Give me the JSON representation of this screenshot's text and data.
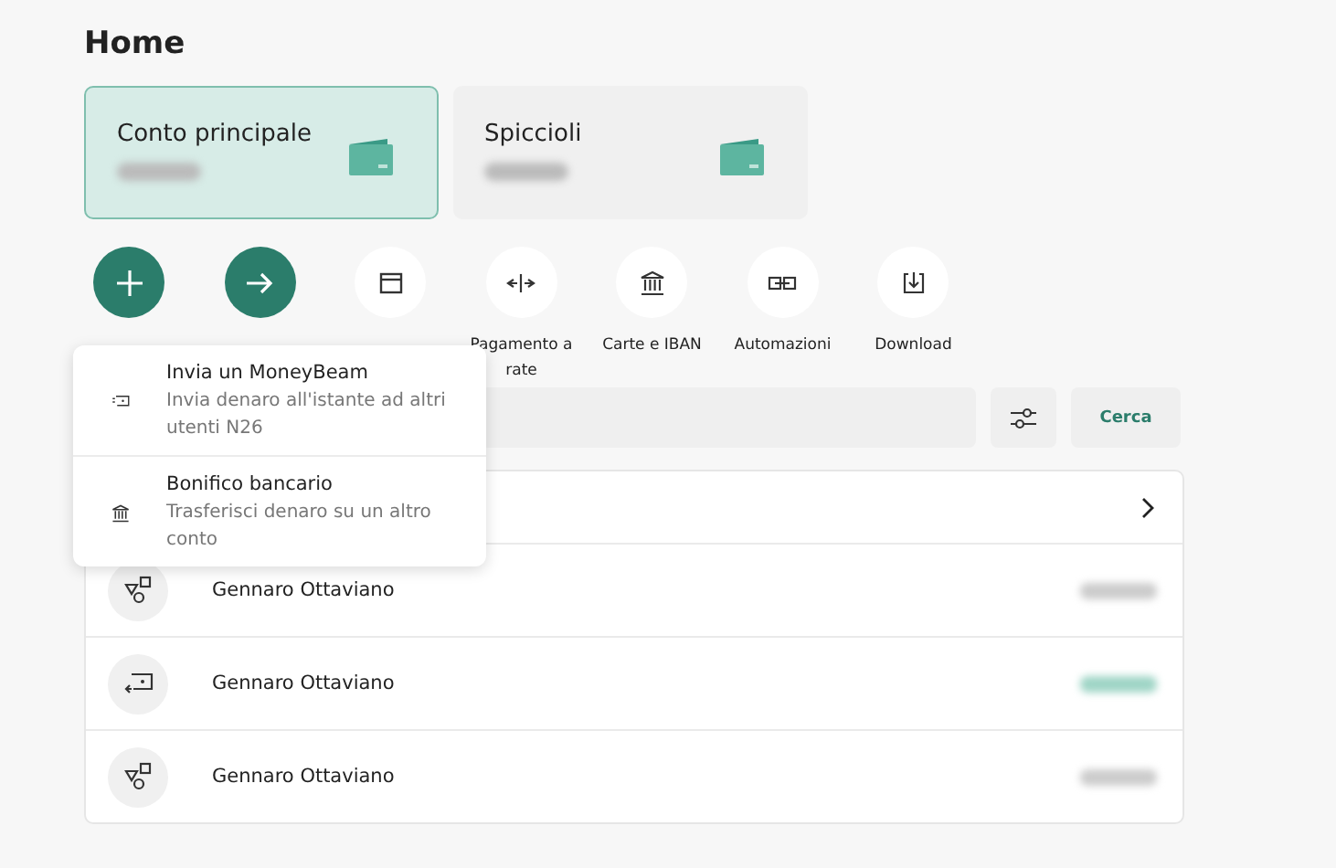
{
  "title": "Home",
  "accounts": [
    {
      "name": "Conto principale",
      "selected": true
    },
    {
      "name": "Spiccioli",
      "selected": false
    }
  ],
  "actions": [
    {
      "kind": "plus",
      "primary": true
    },
    {
      "kind": "arrow",
      "primary": true
    },
    {
      "kind": "calendar",
      "primary": false
    },
    {
      "kind": "split",
      "primary": false,
      "label": "Pagamento a rate"
    },
    {
      "kind": "bank",
      "primary": false,
      "label": "Carte e IBAN"
    },
    {
      "kind": "link",
      "primary": false,
      "label": "Automazioni"
    },
    {
      "kind": "download",
      "primary": false,
      "label": "Download"
    }
  ],
  "search": {
    "button": "Cerca"
  },
  "transactions": [
    {
      "name": "Gennaro Ottaviano",
      "kind": "shapes",
      "incoming": false
    },
    {
      "name": "Gennaro Ottaviano",
      "kind": "beam",
      "incoming": true
    },
    {
      "name": "Gennaro Ottaviano",
      "kind": "shapes",
      "incoming": false
    }
  ],
  "menu": [
    {
      "kind": "beam",
      "title": "Invia un MoneyBeam",
      "description": "Invia denaro all'istante ad altri utenti N26"
    },
    {
      "kind": "bank",
      "title": "Bonifico bancario",
      "description": "Trasferisci denaro su un altro conto"
    }
  ]
}
